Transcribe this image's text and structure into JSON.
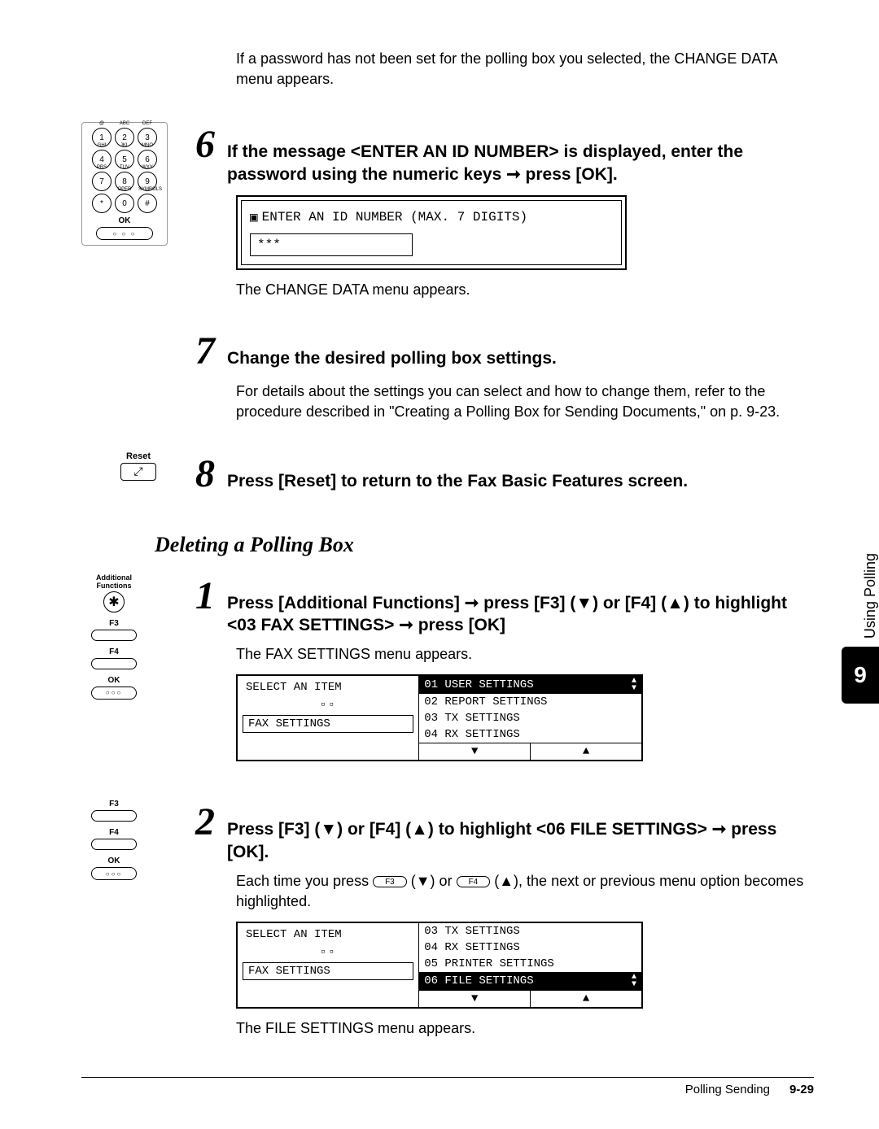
{
  "intro": "If a password has not been set for the polling box you selected, the CHANGE DATA menu appears.",
  "step6": {
    "num": "6",
    "title_part1": "If the message <ENTER AN ID NUMBER> is displayed, enter the password using the numeric keys ",
    "title_arrow": "➞",
    "title_part2": " press [OK].",
    "lcd_title": "ENTER AN ID NUMBER (MAX. 7 DIGITS)",
    "lcd_value": "***",
    "after": "The CHANGE DATA menu appears."
  },
  "step7": {
    "num": "7",
    "title": "Change the desired polling box settings.",
    "body": "For details about the settings you can select and how to change them, refer to the procedure described in \"Creating a Polling Box for Sending Documents,\" on p. 9-23."
  },
  "step8": {
    "num": "8",
    "title": "Press [Reset] to return to the Fax Basic Features screen."
  },
  "section_title": "Deleting a Polling Box",
  "d_step1": {
    "num": "1",
    "title_a": "Press [Additional Functions] ",
    "title_b": " press [F3] (▼) or [F4] (▲) to highlight <03 FAX SETTINGS> ",
    "title_c": " press [OK]",
    "arrow": "➞",
    "after": "The FAX SETTINGS menu appears.",
    "lcd_left_label": "SELECT AN ITEM",
    "lcd_left_select": "FAX SETTINGS",
    "menu": [
      "01 USER SETTINGS",
      "02 REPORT SETTINGS",
      "03 TX SETTINGS",
      "04 RX SETTINGS"
    ],
    "highlight_index": 0
  },
  "d_step2": {
    "num": "2",
    "title_a": "Press [F3] (▼) or [F4] (▲) to highlight <06 FILE SETTINGS> ",
    "title_b": " press [OK].",
    "arrow": "➞",
    "body_a": "Each time you press ",
    "body_b": " (▼) or ",
    "body_c": " (▲), the next or previous menu option becomes highlighted.",
    "key_f3": "F3",
    "key_f4": "F4",
    "lcd_left_label": "SELECT AN ITEM",
    "lcd_left_select": "FAX SETTINGS",
    "menu": [
      "03 TX SETTINGS",
      "04 RX SETTINGS",
      "05 PRINTER SETTINGS",
      "06 FILE SETTINGS"
    ],
    "highlight_index": 3,
    "after": "The FILE SETTINGS menu appears."
  },
  "sidebar": {
    "label": "Using Polling",
    "chapter": "9"
  },
  "footer": {
    "section": "Polling Sending",
    "page": "9-29"
  },
  "icons": {
    "reset": "Reset",
    "addfunc": "Additional Functions",
    "f3": "F3",
    "f4": "F4",
    "ok": "OK"
  },
  "keypad": {
    "rows": [
      [
        {
          "n": "1",
          "t": "@"
        },
        {
          "n": "2",
          "t": "ABC"
        },
        {
          "n": "3",
          "t": "DEF"
        }
      ],
      [
        {
          "n": "4",
          "t": "GHI"
        },
        {
          "n": "5",
          "t": "JKL"
        },
        {
          "n": "6",
          "t": "MNO"
        }
      ],
      [
        {
          "n": "7",
          "t": "PRS"
        },
        {
          "n": "8",
          "t": "TUV"
        },
        {
          "n": "9",
          "t": "WXY"
        }
      ],
      [
        {
          "n": "*",
          "t": ""
        },
        {
          "n": "0",
          "t": "OPER"
        },
        {
          "n": "#",
          "t": "SYMBOLS"
        }
      ]
    ]
  }
}
